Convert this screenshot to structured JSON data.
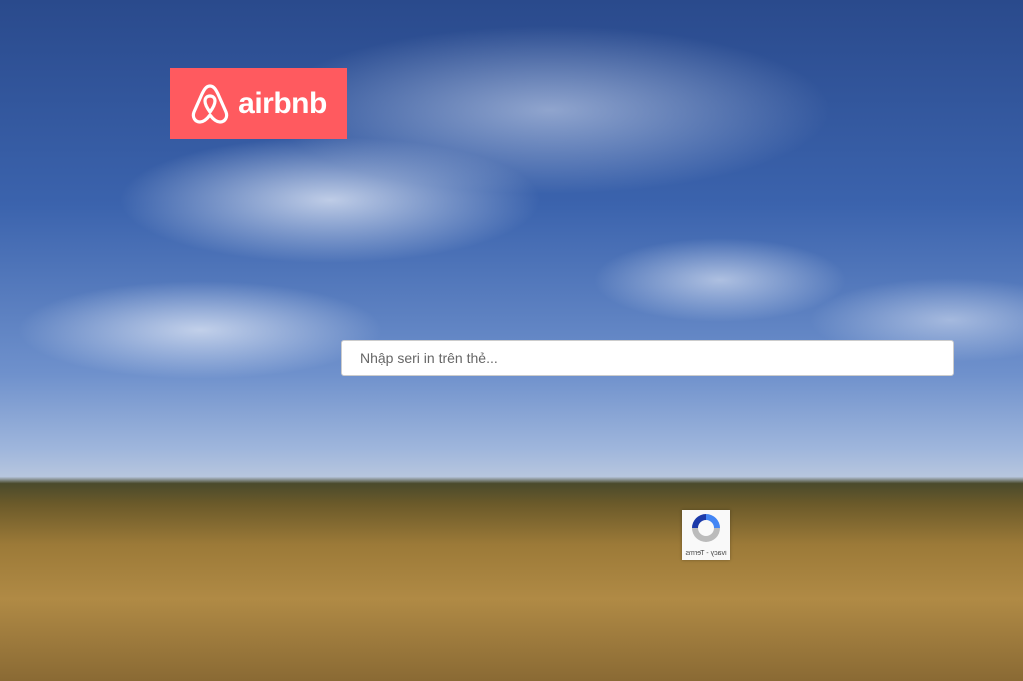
{
  "brand": {
    "name": "airbnb",
    "color": "#ff5a5f"
  },
  "search": {
    "placeholder": "Nhập seri in trên thẻ...",
    "value": ""
  },
  "recaptcha": {
    "text": "ivacy - Terms",
    "icon": "recaptcha-icon"
  }
}
